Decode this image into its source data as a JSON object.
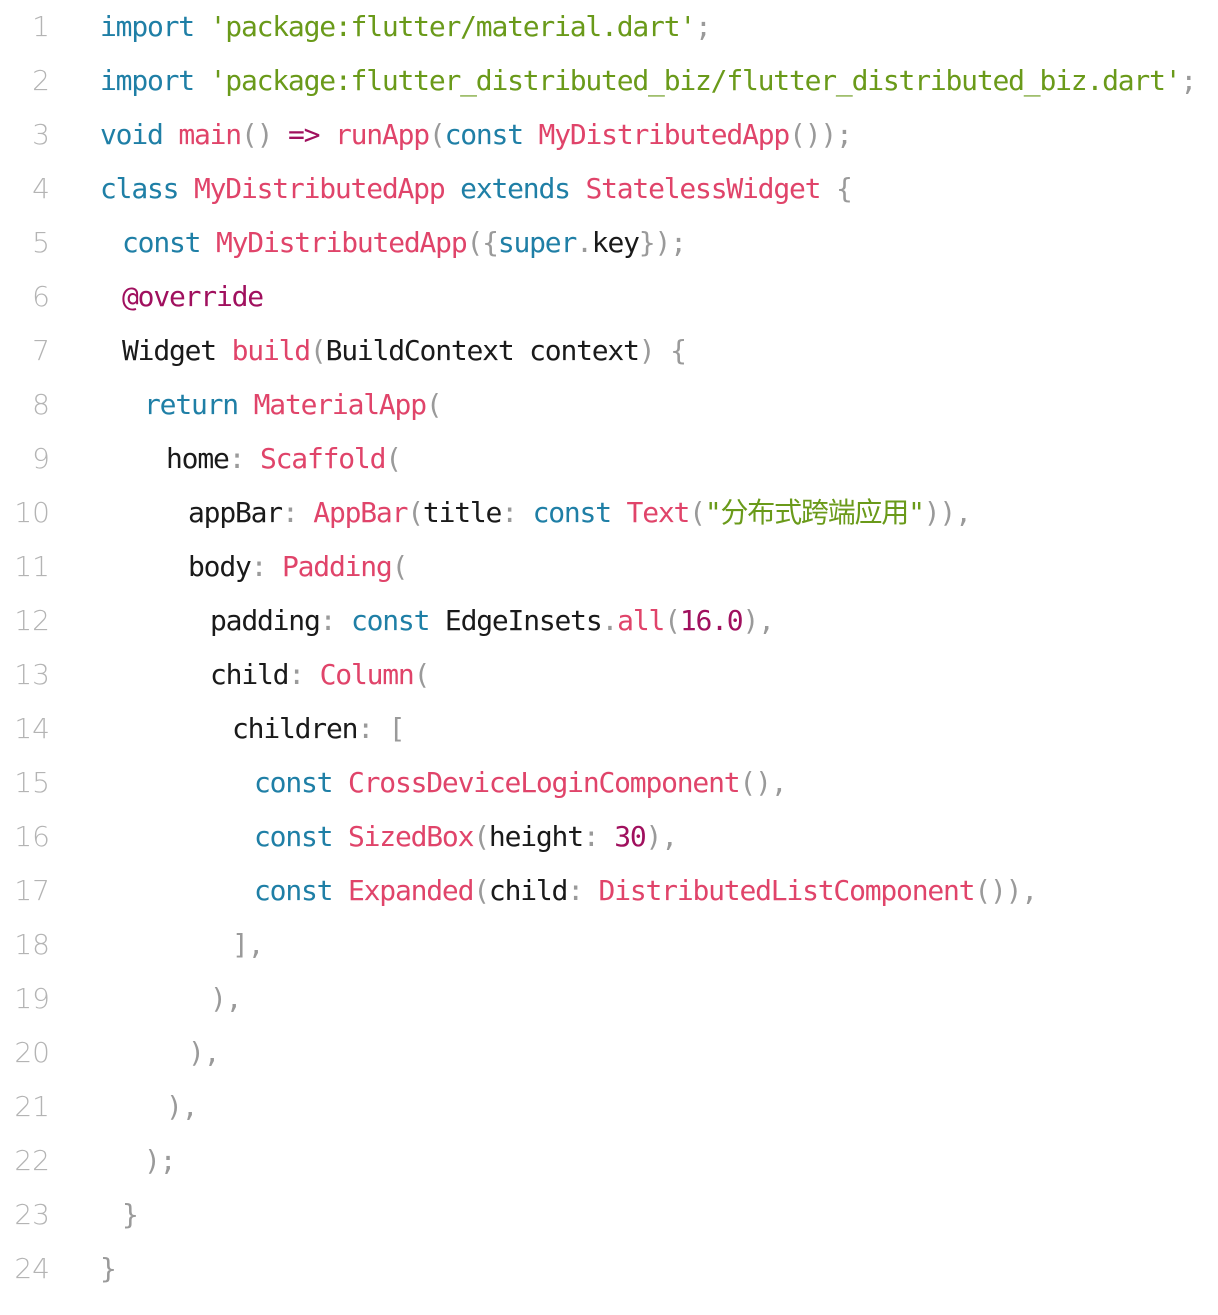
{
  "colors": {
    "keyword": "#1f7fa6",
    "string": "#6a9a1a",
    "class": "#e0446a",
    "annotation": "#a0105e",
    "number": "#a0105e",
    "identifier": "#1a1a1a",
    "punctuation": "#9a9a9a",
    "line_number": "#b4b4b4"
  },
  "lines": [
    {
      "n": "1",
      "indent": 0,
      "tokens": [
        {
          "t": "kw",
          "v": "import"
        },
        {
          "t": "id",
          "v": " "
        },
        {
          "t": "str",
          "v": "'package:flutter/material.dart'"
        },
        {
          "t": "p",
          "v": ";"
        }
      ]
    },
    {
      "n": "2",
      "indent": 0,
      "tokens": [
        {
          "t": "kw",
          "v": "import"
        },
        {
          "t": "id",
          "v": " "
        },
        {
          "t": "str",
          "v": "'package:flutter_distributed_biz/flutter_distributed_biz.dart'"
        },
        {
          "t": "p",
          "v": ";"
        }
      ]
    },
    {
      "n": "3",
      "indent": 0,
      "tokens": [
        {
          "t": "kw",
          "v": "void"
        },
        {
          "t": "id",
          "v": " "
        },
        {
          "t": "fn",
          "v": "main"
        },
        {
          "t": "p",
          "v": "()"
        },
        {
          "t": "id",
          "v": " "
        },
        {
          "t": "ann",
          "v": "=>"
        },
        {
          "t": "id",
          "v": " "
        },
        {
          "t": "fn",
          "v": "runApp"
        },
        {
          "t": "p",
          "v": "("
        },
        {
          "t": "kw",
          "v": "const"
        },
        {
          "t": "id",
          "v": " "
        },
        {
          "t": "cls",
          "v": "MyDistributedApp"
        },
        {
          "t": "p",
          "v": "());"
        }
      ]
    },
    {
      "n": "4",
      "indent": 0,
      "tokens": [
        {
          "t": "kw",
          "v": "class"
        },
        {
          "t": "id",
          "v": " "
        },
        {
          "t": "cls",
          "v": "MyDistributedApp"
        },
        {
          "t": "id",
          "v": " "
        },
        {
          "t": "kw",
          "v": "extends"
        },
        {
          "t": "id",
          "v": " "
        },
        {
          "t": "cls",
          "v": "StatelessWidget"
        },
        {
          "t": "id",
          "v": " "
        },
        {
          "t": "p",
          "v": "{"
        }
      ]
    },
    {
      "n": "5",
      "indent": 1,
      "tokens": [
        {
          "t": "kw",
          "v": "const"
        },
        {
          "t": "id",
          "v": " "
        },
        {
          "t": "cls",
          "v": "MyDistributedApp"
        },
        {
          "t": "p",
          "v": "({"
        },
        {
          "t": "kw",
          "v": "super"
        },
        {
          "t": "p",
          "v": "."
        },
        {
          "t": "id",
          "v": "key"
        },
        {
          "t": "p",
          "v": "});"
        }
      ]
    },
    {
      "n": "6",
      "indent": 1,
      "tokens": [
        {
          "t": "ann",
          "v": "@override"
        }
      ]
    },
    {
      "n": "7",
      "indent": 1,
      "tokens": [
        {
          "t": "id",
          "v": "Widget"
        },
        {
          "t": "id",
          "v": " "
        },
        {
          "t": "fn",
          "v": "build"
        },
        {
          "t": "p",
          "v": "("
        },
        {
          "t": "id",
          "v": "BuildContext context"
        },
        {
          "t": "p",
          "v": ")"
        },
        {
          "t": "id",
          "v": " "
        },
        {
          "t": "p",
          "v": "{"
        }
      ]
    },
    {
      "n": "8",
      "indent": 2,
      "tokens": [
        {
          "t": "kw",
          "v": "return"
        },
        {
          "t": "id",
          "v": " "
        },
        {
          "t": "cls",
          "v": "MaterialApp"
        },
        {
          "t": "p",
          "v": "("
        }
      ]
    },
    {
      "n": "9",
      "indent": 3,
      "tokens": [
        {
          "t": "id",
          "v": "home"
        },
        {
          "t": "p",
          "v": ":"
        },
        {
          "t": "id",
          "v": " "
        },
        {
          "t": "cls",
          "v": "Scaffold"
        },
        {
          "t": "p",
          "v": "("
        }
      ]
    },
    {
      "n": "10",
      "indent": 4,
      "tokens": [
        {
          "t": "id",
          "v": "appBar"
        },
        {
          "t": "p",
          "v": ":"
        },
        {
          "t": "id",
          "v": " "
        },
        {
          "t": "cls",
          "v": "AppBar"
        },
        {
          "t": "p",
          "v": "("
        },
        {
          "t": "id",
          "v": "title"
        },
        {
          "t": "p",
          "v": ":"
        },
        {
          "t": "id",
          "v": " "
        },
        {
          "t": "kw",
          "v": "const"
        },
        {
          "t": "id",
          "v": " "
        },
        {
          "t": "cls",
          "v": "Text"
        },
        {
          "t": "p",
          "v": "("
        },
        {
          "t": "str",
          "v": "\"分布式跨端应用\""
        },
        {
          "t": "p",
          "v": ")),"
        }
      ]
    },
    {
      "n": "11",
      "indent": 4,
      "tokens": [
        {
          "t": "id",
          "v": "body"
        },
        {
          "t": "p",
          "v": ":"
        },
        {
          "t": "id",
          "v": " "
        },
        {
          "t": "cls",
          "v": "Padding"
        },
        {
          "t": "p",
          "v": "("
        }
      ]
    },
    {
      "n": "12",
      "indent": 5,
      "tokens": [
        {
          "t": "id",
          "v": "padding"
        },
        {
          "t": "p",
          "v": ":"
        },
        {
          "t": "id",
          "v": " "
        },
        {
          "t": "kw",
          "v": "const"
        },
        {
          "t": "id",
          "v": " "
        },
        {
          "t": "id",
          "v": "EdgeInsets"
        },
        {
          "t": "p",
          "v": "."
        },
        {
          "t": "fn",
          "v": "all"
        },
        {
          "t": "p",
          "v": "("
        },
        {
          "t": "num",
          "v": "16.0"
        },
        {
          "t": "p",
          "v": "),"
        }
      ]
    },
    {
      "n": "13",
      "indent": 5,
      "tokens": [
        {
          "t": "id",
          "v": "child"
        },
        {
          "t": "p",
          "v": ":"
        },
        {
          "t": "id",
          "v": " "
        },
        {
          "t": "cls",
          "v": "Column"
        },
        {
          "t": "p",
          "v": "("
        }
      ]
    },
    {
      "n": "14",
      "indent": 6,
      "tokens": [
        {
          "t": "id",
          "v": "children"
        },
        {
          "t": "p",
          "v": ":"
        },
        {
          "t": "id",
          "v": " "
        },
        {
          "t": "p",
          "v": "["
        }
      ]
    },
    {
      "n": "15",
      "indent": 7,
      "tokens": [
        {
          "t": "kw",
          "v": "const"
        },
        {
          "t": "id",
          "v": " "
        },
        {
          "t": "cls",
          "v": "CrossDeviceLoginComponent"
        },
        {
          "t": "p",
          "v": "(),"
        }
      ]
    },
    {
      "n": "16",
      "indent": 7,
      "tokens": [
        {
          "t": "kw",
          "v": "const"
        },
        {
          "t": "id",
          "v": " "
        },
        {
          "t": "cls",
          "v": "SizedBox"
        },
        {
          "t": "p",
          "v": "("
        },
        {
          "t": "id",
          "v": "height"
        },
        {
          "t": "p",
          "v": ":"
        },
        {
          "t": "id",
          "v": " "
        },
        {
          "t": "num",
          "v": "30"
        },
        {
          "t": "p",
          "v": "),"
        }
      ]
    },
    {
      "n": "17",
      "indent": 7,
      "tokens": [
        {
          "t": "kw",
          "v": "const"
        },
        {
          "t": "id",
          "v": " "
        },
        {
          "t": "cls",
          "v": "Expanded"
        },
        {
          "t": "p",
          "v": "("
        },
        {
          "t": "id",
          "v": "child"
        },
        {
          "t": "p",
          "v": ":"
        },
        {
          "t": "id",
          "v": " "
        },
        {
          "t": "cls",
          "v": "DistributedListComponent"
        },
        {
          "t": "p",
          "v": "()),"
        }
      ]
    },
    {
      "n": "18",
      "indent": 6,
      "tokens": [
        {
          "t": "p",
          "v": "],"
        }
      ]
    },
    {
      "n": "19",
      "indent": 5,
      "tokens": [
        {
          "t": "p",
          "v": "),"
        }
      ]
    },
    {
      "n": "20",
      "indent": 4,
      "tokens": [
        {
          "t": "p",
          "v": "),"
        }
      ]
    },
    {
      "n": "21",
      "indent": 3,
      "tokens": [
        {
          "t": "p",
          "v": "),"
        }
      ]
    },
    {
      "n": "22",
      "indent": 2,
      "tokens": [
        {
          "t": "p",
          "v": ");"
        }
      ]
    },
    {
      "n": "23",
      "indent": 1,
      "tokens": [
        {
          "t": "p",
          "v": "}"
        }
      ]
    },
    {
      "n": "24",
      "indent": 0,
      "tokens": [
        {
          "t": "p",
          "v": "}"
        }
      ]
    }
  ]
}
